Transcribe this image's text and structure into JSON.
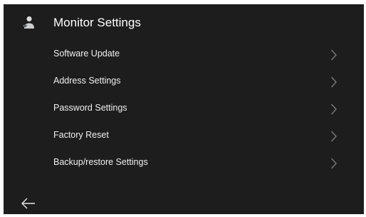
{
  "header": {
    "title": "Monitor Settings",
    "icon": "settings-person-icon"
  },
  "menu": {
    "items": [
      {
        "label": "Software Update",
        "icon": "chevron-right-icon"
      },
      {
        "label": "Address Settings",
        "icon": "chevron-right-icon"
      },
      {
        "label": "Password Settings",
        "icon": "chevron-right-icon"
      },
      {
        "label": "Factory Reset",
        "icon": "chevron-right-icon"
      },
      {
        "label": "Backup/restore Settings",
        "icon": "chevron-right-icon"
      }
    ]
  },
  "footer": {
    "back_icon": "back-arrow-icon"
  },
  "colors": {
    "background": "#1d1d1d",
    "text": "#ffffff",
    "chevron": "#7a7a7a"
  }
}
